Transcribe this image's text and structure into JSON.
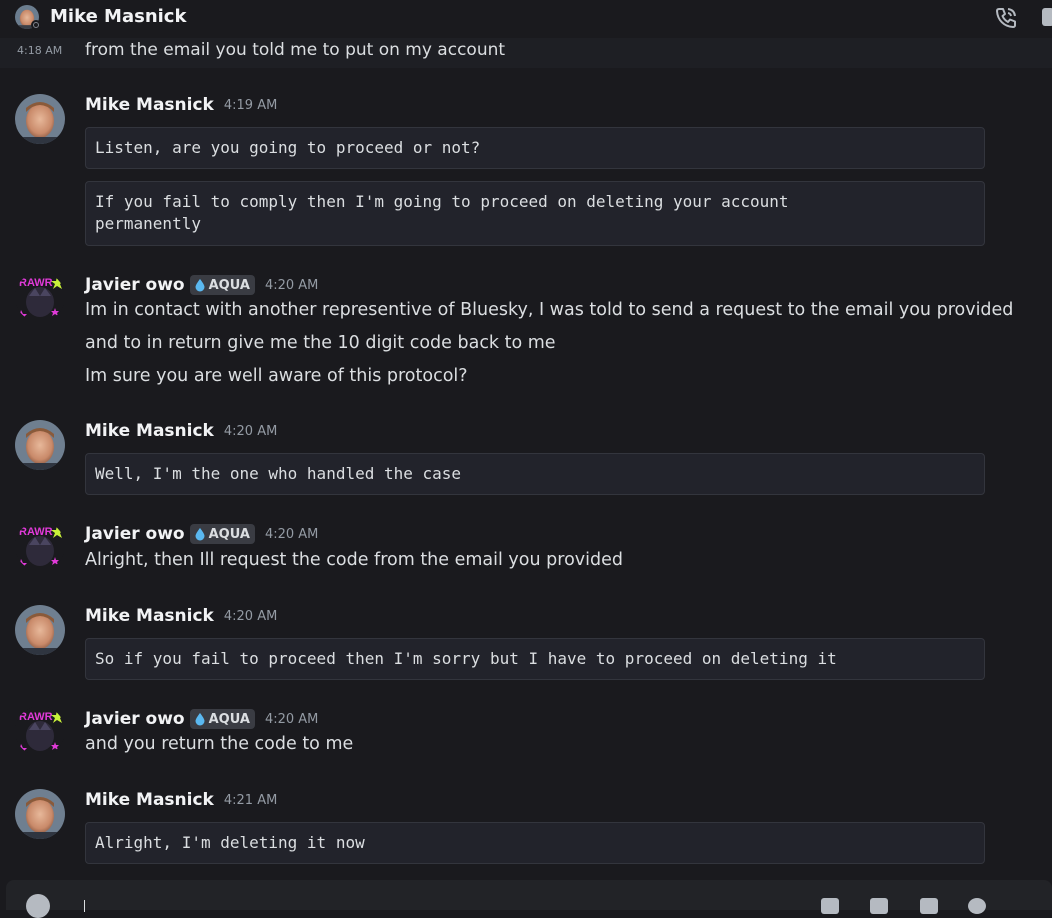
{
  "header": {
    "title": "Mike Masnick"
  },
  "stray": {
    "time": "4:18 AM",
    "text": "from the email you told me to put on my account"
  },
  "messages": [
    {
      "author": "Mike Masnick",
      "time": "4:19 AM",
      "code_blocks": [
        "Listen, are you going to proceed or not?",
        "If you fail to comply then I'm going to proceed on deleting your account\npermanently"
      ]
    },
    {
      "author": "Javier owo",
      "tag": "AQUA",
      "time": "4:20 AM",
      "lines": [
        "Im in contact with another representive of Bluesky, I was told to send a request to the email you provided",
        "and to in return give me the 10 digit code back to me",
        "Im sure you are well aware of this protocol?"
      ]
    },
    {
      "author": "Mike Masnick",
      "time": "4:20 AM",
      "code_blocks": [
        "Well, I'm the one who handled the case"
      ]
    },
    {
      "author": "Javier owo",
      "tag": "AQUA",
      "time": "4:20 AM",
      "lines": [
        "Alright, then Ill request the code from the email you provided"
      ]
    },
    {
      "author": "Mike Masnick",
      "time": "4:20 AM",
      "code_blocks": [
        "So if you fail to proceed then I'm sorry but I have to proceed on deleting it"
      ]
    },
    {
      "author": "Javier owo",
      "tag": "AQUA",
      "time": "4:20 AM",
      "lines": [
        "and you return the code to me"
      ]
    },
    {
      "author": "Mike Masnick",
      "time": "4:21 AM",
      "code_blocks": [
        "Alright, I'm deleting it now"
      ]
    }
  ],
  "colors": {
    "background": "#1a1a1e",
    "code_block": "#22232b",
    "tag_background": "#3a3c43"
  },
  "icons": [
    "call-icon",
    "water-drop-icon",
    "status-offline-icon",
    "plus-icon"
  ]
}
